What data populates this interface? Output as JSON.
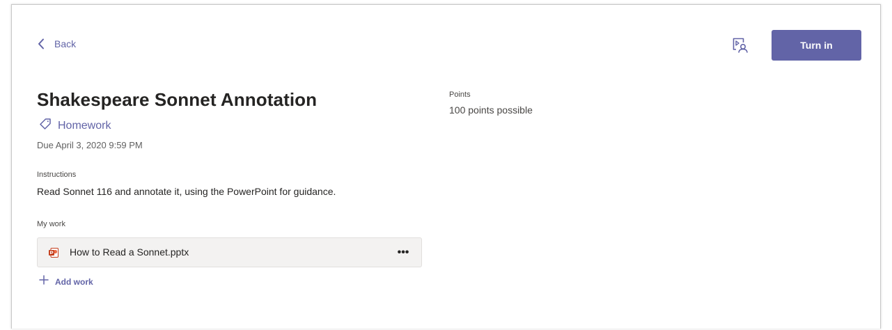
{
  "header": {
    "back_label": "Back",
    "turn_in_label": "Turn in"
  },
  "assignment": {
    "title": "Shakespeare Sonnet Annotation",
    "category": "Homework",
    "due": "Due April 3, 2020 9:59 PM"
  },
  "instructions": {
    "label": "Instructions",
    "text": "Read Sonnet 116 and annotate it, using the PowerPoint for guidance."
  },
  "my_work": {
    "label": "My work",
    "files": [
      {
        "name": "How to Read a Sonnet.pptx",
        "icon": "powerpoint-file-icon",
        "more": "•••"
      }
    ],
    "add_work_label": "Add work"
  },
  "points": {
    "label": "Points",
    "value": "100 points possible"
  },
  "icons": {
    "back": "chevron-left-icon",
    "view": "student-view-icon",
    "category": "tag-icon",
    "add": "plus-icon"
  },
  "colors": {
    "accent": "#6264a7",
    "file_card_bg": "#f3f2f1",
    "text": "#252423",
    "muted": "#616161",
    "powerpoint": "#c43e1c"
  }
}
